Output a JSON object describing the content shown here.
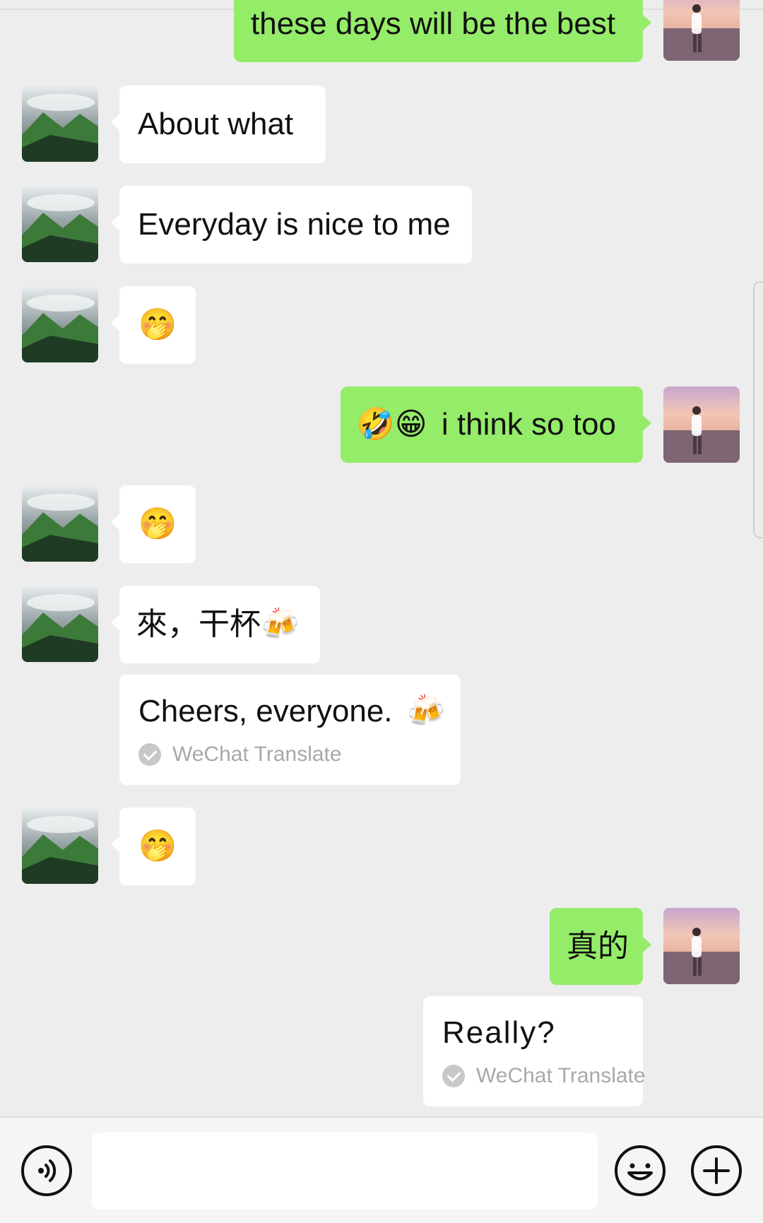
{
  "messages": [
    {
      "side": "out",
      "text": "these days will be the best"
    },
    {
      "side": "in",
      "text": "About what"
    },
    {
      "side": "in",
      "text": "Everyday is nice to me"
    },
    {
      "side": "in",
      "emoji": "🤭"
    },
    {
      "side": "out",
      "emoji": "🤣😁",
      "text": "i think so too"
    },
    {
      "side": "in",
      "emoji": "🤭"
    },
    {
      "side": "in",
      "text": "來，干杯",
      "emoji": "🍻"
    },
    {
      "side": "in",
      "translation": "Cheers, everyone.",
      "emoji": "🍻",
      "translation_label": "WeChat Translate"
    },
    {
      "side": "in",
      "emoji": "🤭"
    },
    {
      "side": "out",
      "text": "真的"
    },
    {
      "side": "out",
      "translation": "Really?",
      "translation_label": "WeChat Translate"
    }
  ],
  "input": {
    "value": ""
  },
  "icons": {
    "voice": "voice-input-icon",
    "sticker": "emoji-smiley-icon",
    "more": "add-plus-icon",
    "translated": "check-circle-icon",
    "avatar_in": "mountain-landscape-avatar",
    "avatar_out": "beach-sunset-avatar"
  },
  "colors": {
    "background": "#ededed",
    "outgoing_bubble": "#95ec69",
    "incoming_bubble": "#ffffff",
    "translate_label": "#a8a8a8"
  }
}
